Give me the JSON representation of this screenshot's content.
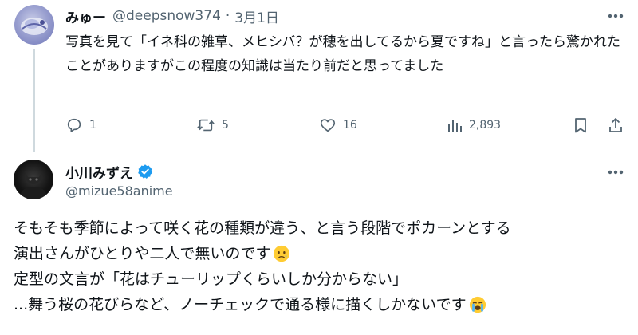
{
  "parent_tweet": {
    "author_name": "みゅー",
    "handle": "@deepsnow374",
    "separator": "·",
    "date": "3月1日",
    "text": "写真を見て「イネ科の雑草、メヒシバ？が穂を出してるから夏ですね」と言ったら驚かれたことがありますがこの程度の知識は当たり前だと思ってました",
    "replies": "1",
    "reposts": "5",
    "likes": "16",
    "views": "2,893"
  },
  "reply_tweet": {
    "author_name": "小川みずえ",
    "handle": "@mizue58anime",
    "verified": true,
    "lines": [
      "そもそも季節によって咲く花の種類が違う、と言う段階でポカーンとする",
      "演出さんがひとりや二人で無いのです",
      "定型の文言が「花はチューリップくらいしか分からない」",
      "...舞う桜の花びらなど、ノーチェックで通る様に描くしかないです"
    ]
  },
  "colors": {
    "text": "#0f1419",
    "muted": "#536471",
    "verified_blue": "#1d9bf0",
    "thread_line": "#cfd9de"
  },
  "icons": [
    "reply-icon",
    "repost-icon",
    "like-icon",
    "views-icon",
    "bookmark-icon",
    "share-icon",
    "more-icon",
    "verified-badge-icon",
    "sad-emoji",
    "crying-emoji"
  ]
}
